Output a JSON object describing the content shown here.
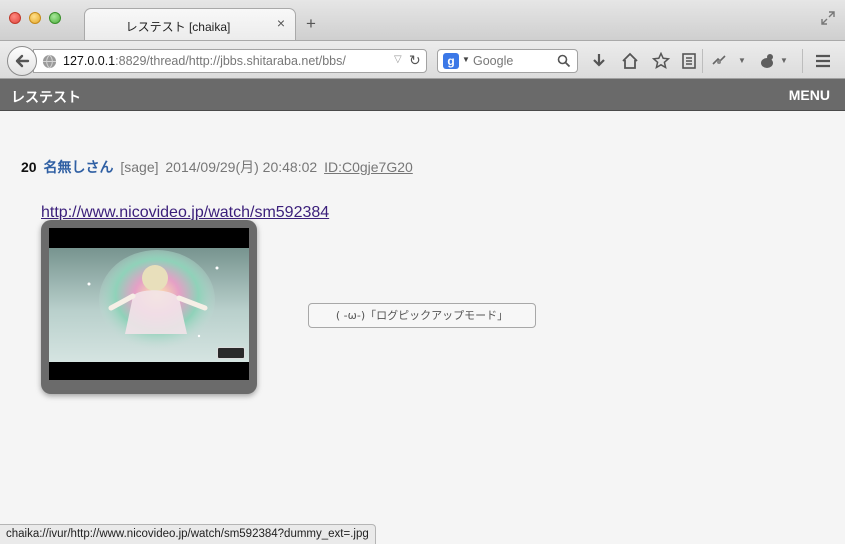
{
  "browser": {
    "tab_title": "レステスト [chaika]",
    "tab_close": "×",
    "new_tab": "+",
    "url_host": "127.0.0.1",
    "url_rest": ":8829/thread/http://jbbs.shitaraba.net/bbs/",
    "reload_glyph": "↻",
    "search_engine": "g",
    "search_placeholder": "Google",
    "status_text": "chaika://ivur/http://www.nicovideo.jp/watch/sm592384?dummy_ext=.jpg"
  },
  "app": {
    "title": "レステスト",
    "menu_label": "MENU"
  },
  "post": {
    "number": "20",
    "name": "名無しさん",
    "mail": "[sage]",
    "date": "2014/09/29(月) 20:48:02",
    "id": "ID:C0gje7G20",
    "link": "http://www.nicovideo.jp/watch/sm592384"
  },
  "pickup_button": "( -ω-)「ログピックアップモード」",
  "colors": {
    "app_header": "#6a6a6a",
    "poster_name": "#2f5fa3",
    "link_visited": "#3a1e7a",
    "page_bg": "#f5f5f5"
  }
}
